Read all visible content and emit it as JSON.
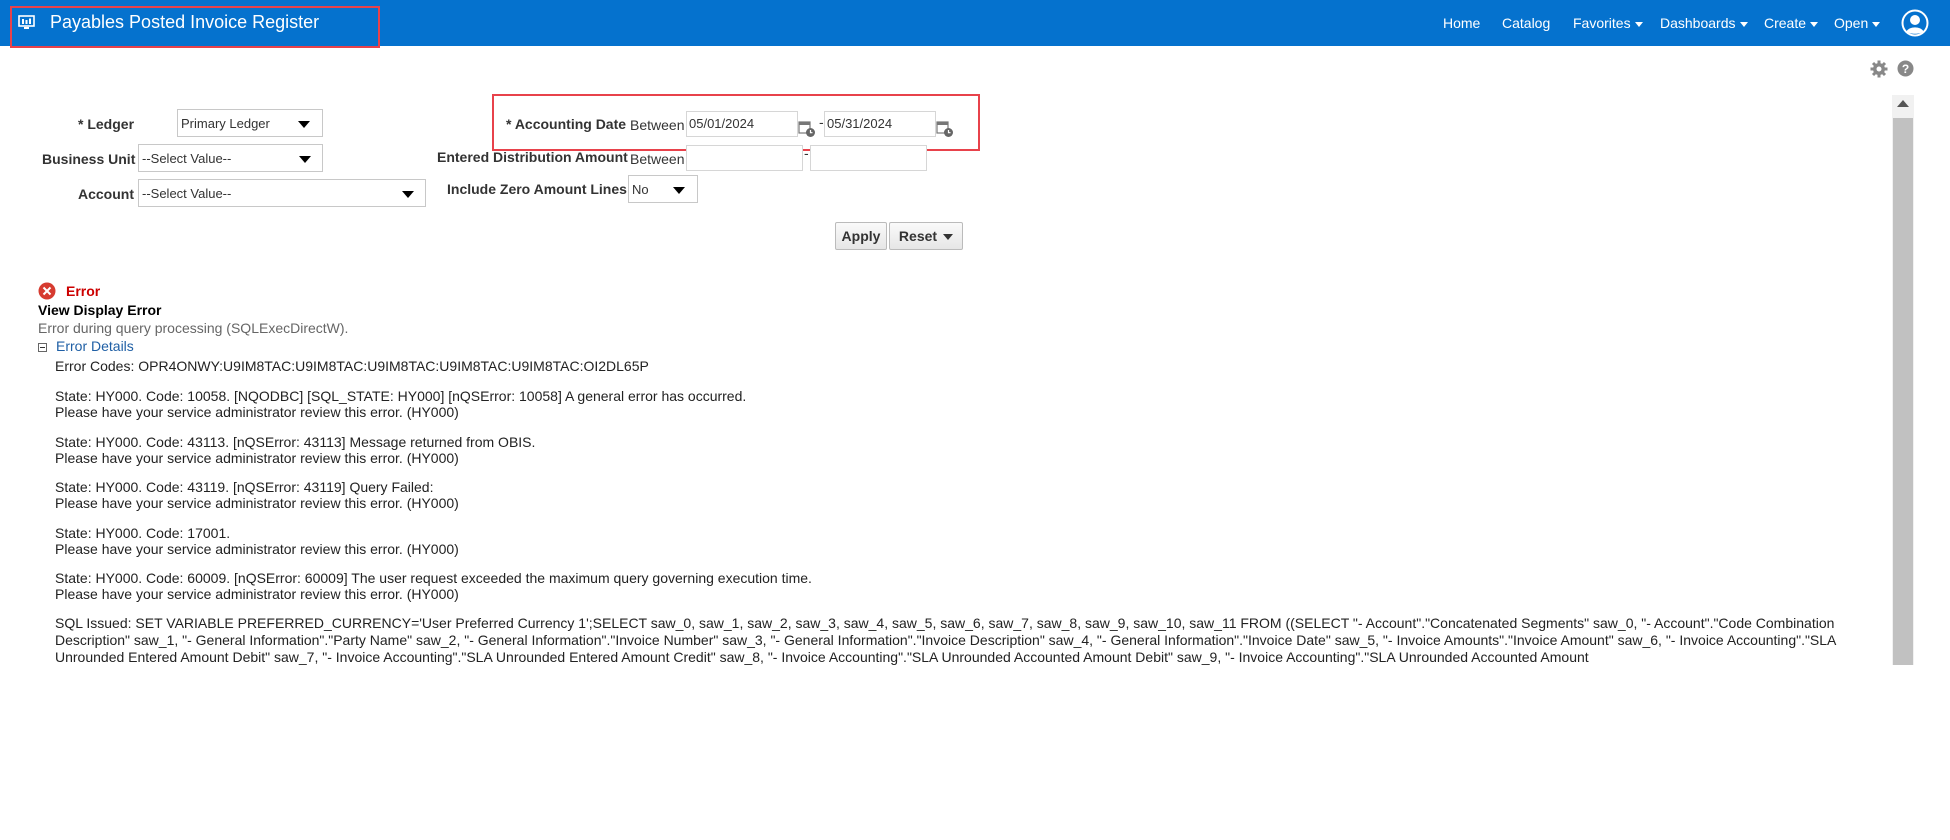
{
  "header": {
    "title": "Payables Posted Invoice Register",
    "nav": [
      {
        "label": "Home",
        "has_menu": false
      },
      {
        "label": "Catalog",
        "has_menu": false
      },
      {
        "label": "Favorites",
        "has_menu": true
      },
      {
        "label": "Dashboards",
        "has_menu": true
      },
      {
        "label": "Create",
        "has_menu": true
      },
      {
        "label": "Open",
        "has_menu": true
      }
    ],
    "bar_color": "#0572ce"
  },
  "prompts": {
    "ledger": {
      "label": "* Ledger",
      "value": "Primary Ledger"
    },
    "business_unit": {
      "label": "Business Unit",
      "value": "--Select Value--"
    },
    "account": {
      "label": "Account",
      "value": "--Select Value--"
    },
    "accounting_date": {
      "label": "* Accounting Date",
      "operator": "Between",
      "from": "05/01/2024",
      "to": "05/31/2024"
    },
    "entered_distribution_amount": {
      "label": "Entered Distribution Amount",
      "operator": "Between",
      "from": "",
      "to": ""
    },
    "include_zero_amount_lines": {
      "label": "Include Zero Amount Lines",
      "value": "No"
    },
    "apply_label": "Apply",
    "reset_label": "Reset",
    "dash": "-"
  },
  "error": {
    "title": "Error",
    "subtitle": "View Display Error",
    "message": "Error during query processing (SQLExecDirectW).",
    "details_label": "Error Details",
    "codes": "Error Codes: OPR4ONWY:U9IM8TAC:U9IM8TAC:U9IM8TAC:U9IM8TAC:U9IM8TAC:OI2DL65P",
    "states": [
      {
        "line1": "State: HY000. Code: 10058. [NQODBC] [SQL_STATE: HY000] [nQSError: 10058] A general error has occurred.",
        "line2": "Please have your service administrator review this error. (HY000)"
      },
      {
        "line1": "State: HY000. Code: 43113. [nQSError: 43113] Message returned from OBIS.",
        "line2": "Please have your service administrator review this error. (HY000)"
      },
      {
        "line1": "State: HY000. Code: 43119. [nQSError: 43119] Query Failed:",
        "line2": "Please have your service administrator review this error. (HY000)"
      },
      {
        "line1": "State: HY000. Code: 17001.",
        "line2": "Please have your service administrator review this error. (HY000)"
      },
      {
        "line1": "State: HY000. Code: 60009. [nQSError: 60009] The user request exceeded the maximum query governing execution time.",
        "line2": "Please have your service administrator review this error. (HY000)"
      }
    ],
    "sql": "SQL Issued: SET VARIABLE PREFERRED_CURRENCY='User Preferred Currency 1';SELECT saw_0, saw_1, saw_2, saw_3, saw_4, saw_5, saw_6, saw_7, saw_8, saw_9, saw_10, saw_11 FROM ((SELECT \"- Account\".\"Concatenated Segments\" saw_0, \"- Account\".\"Code Combination Description\" saw_1, \"- General Information\".\"Party Name\" saw_2, \"- General Information\".\"Invoice Number\" saw_3, \"- General Information\".\"Invoice Description\" saw_4, \"- General Information\".\"Invoice Date\" saw_5, \"- Invoice Amounts\".\"Invoice Amount\" saw_6, \"- Invoice Accounting\".\"SLA Unrounded Entered Amount Debit\" saw_7, \"- Invoice Accounting\".\"SLA Unrounded Entered Amount Credit\" saw_8, \"- Invoice Accounting\".\"SLA Unrounded Accounted Amount Debit\" saw_9, \"- Invoice Accounting\".\"SLA Unrounded Accounted Amount",
    "color": "#cc0000"
  }
}
